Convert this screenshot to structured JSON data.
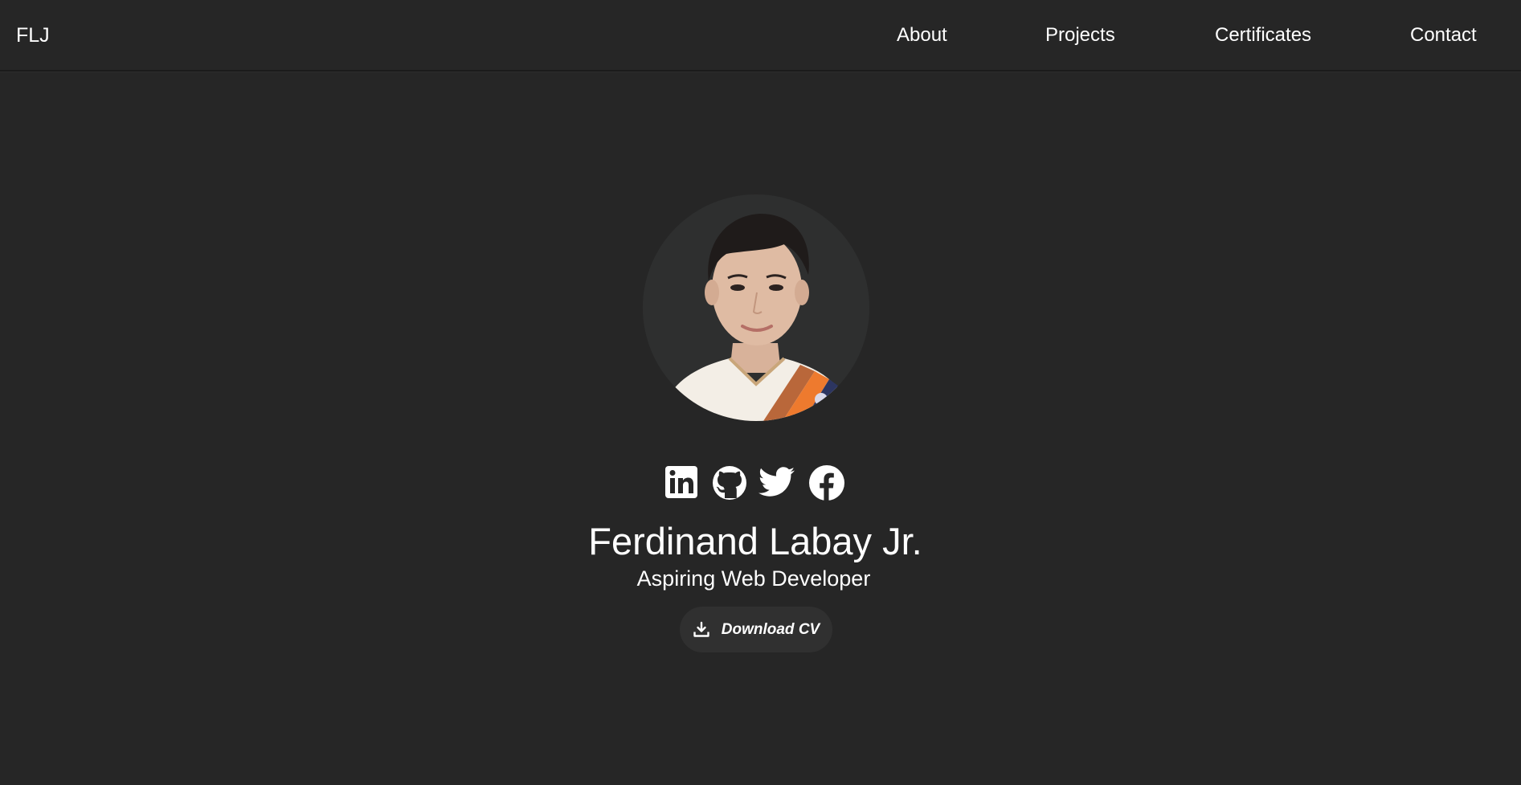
{
  "nav": {
    "logo": "FLJ",
    "links": [
      {
        "label": "About"
      },
      {
        "label": "Projects"
      },
      {
        "label": "Certificates"
      },
      {
        "label": "Contact"
      }
    ]
  },
  "profile": {
    "photo_alt": "Ferdinand Labay Jr. profile photo",
    "name": "Ferdinand Labay Jr.",
    "role": "Aspiring Web Developer"
  },
  "socials": [
    {
      "icon": "linkedin-icon",
      "label": "LinkedIn"
    },
    {
      "icon": "github-icon",
      "label": "GitHub"
    },
    {
      "icon": "twitter-icon",
      "label": "Twitter"
    },
    {
      "icon": "facebook-icon",
      "label": "Facebook"
    }
  ],
  "cv_button": {
    "label": "Download CV",
    "icon": "download-icon"
  },
  "colors": {
    "background": "#262626",
    "text": "#ffffff",
    "button_bg": "#303030"
  }
}
